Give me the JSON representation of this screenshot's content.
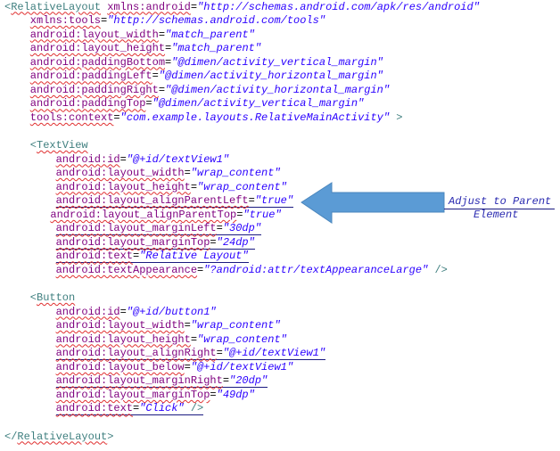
{
  "lines": [
    {
      "indent": 0,
      "open": "<",
      "tag": "RelativeLayout",
      "attr": "xmlns:android",
      "value": "\"http://schemas.android.com/apk/res/android\""
    },
    {
      "indent": 4,
      "attr": "xmlns:tools",
      "value": "\"http://schemas.android.com/tools\""
    },
    {
      "indent": 4,
      "attr": "android:layout_width",
      "value": "\"match_parent\""
    },
    {
      "indent": 4,
      "attr": "android:layout_height",
      "value": "\"match_parent\""
    },
    {
      "indent": 4,
      "attr": "android:paddingBottom",
      "value": "\"@dimen/activity_vertical_margin\""
    },
    {
      "indent": 4,
      "attr": "android:paddingLeft",
      "value": "\"@dimen/activity_horizontal_margin\""
    },
    {
      "indent": 4,
      "attr": "android:paddingRight",
      "value": "\"@dimen/activity_horizontal_margin\""
    },
    {
      "indent": 4,
      "attr": "android:paddingTop",
      "value": "\"@dimen/activity_vertical_margin\""
    },
    {
      "indent": 4,
      "attr": "tools:context",
      "value": "\"com.example.layouts.RelativeMainActivity\"",
      "close": " >"
    },
    {
      "blank": true
    },
    {
      "indent": 4,
      "open": "<",
      "tag": "TextView"
    },
    {
      "indent": 8,
      "attr": "android:id",
      "value": "\"@+id/textView1\""
    },
    {
      "indent": 8,
      "attr": "android:layout_width",
      "value": "\"wrap_content\""
    },
    {
      "indent": 8,
      "attr": "android:layout_height",
      "value": "\"wrap_content\""
    },
    {
      "indent": 8,
      "attr": "android:layout_alignParentLeft",
      "value": "\"true\"",
      "hl": true
    },
    {
      "indent": 7,
      "attr": "android:layout_alignParentTop",
      "value": "\"true\""
    },
    {
      "indent": 8,
      "attr": "android:layout_marginLeft",
      "value": "\"30dp\"",
      "hl": true
    },
    {
      "indent": 8,
      "attr": "android:layout_marginTop",
      "value": "\"24dp\"",
      "hl": true
    },
    {
      "indent": 8,
      "attr": "android:text",
      "value": "\"Relative Layout\"",
      "hl": true
    },
    {
      "indent": 8,
      "attr": "android:textAppearance",
      "value": "\"?android:attr/textAppearanceLarge\"",
      "close": " />"
    },
    {
      "blank": true
    },
    {
      "indent": 4,
      "open": "<",
      "tag": "Button"
    },
    {
      "indent": 8,
      "attr": "android:id",
      "value": "\"@+id/button1\""
    },
    {
      "indent": 8,
      "attr": "android:layout_width",
      "value": "\"wrap_content\""
    },
    {
      "indent": 8,
      "attr": "android:layout_height",
      "value": "\"wrap_content\""
    },
    {
      "indent": 8,
      "attr": "android:layout_alignRight",
      "value": "\"@+id/textView1\"",
      "hl": true
    },
    {
      "indent": 8,
      "attr": "android:layout_below",
      "value": "\"@+id/textView1\""
    },
    {
      "indent": 8,
      "attr": "android:layout_marginRight",
      "value": "\"20dp\"",
      "hl": true
    },
    {
      "indent": 8,
      "attr": "android:layout_marginTop",
      "value": "\"49dp\""
    },
    {
      "indent": 8,
      "attr": "android:text",
      "value": "\"Click\"",
      "close": " />",
      "hl": true
    },
    {
      "blank": true
    },
    {
      "indent": 0,
      "open": "</",
      "tag": "RelativeLayout",
      "close": ">"
    }
  ],
  "annotation": {
    "line1": "Adjust to Parent",
    "line2": "Element",
    "arrow_color": "#5b9bd5"
  }
}
